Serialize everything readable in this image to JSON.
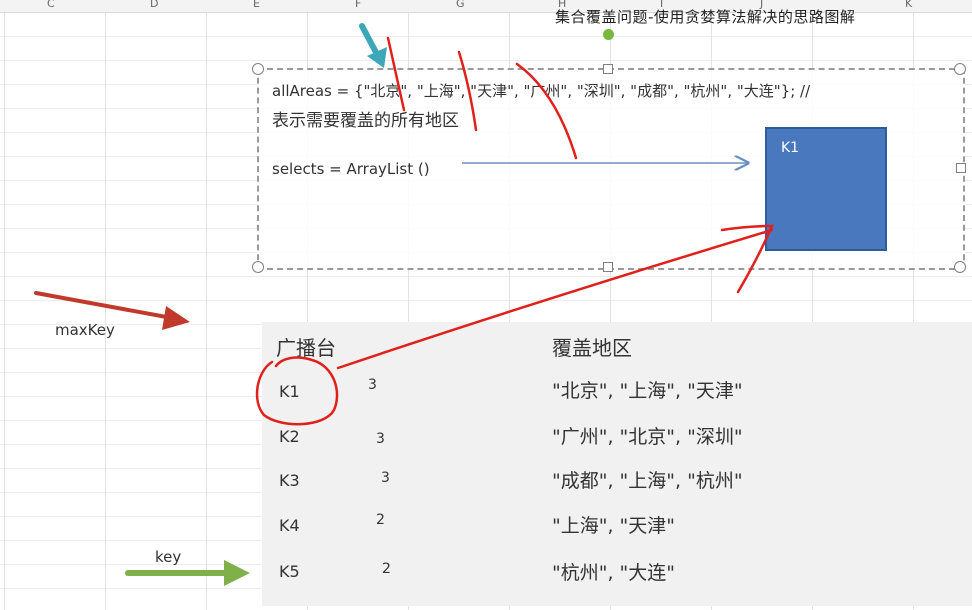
{
  "column_headers": [
    "C",
    "D",
    "E",
    "F",
    "G",
    "H",
    "I",
    "J",
    "K"
  ],
  "title_text": "集合覆盖问题-使用贪婪算法解决的思路图解",
  "code": {
    "line1": "allAreas = {\"北京\", \"上海\", \"天津\", \"广州\", \"深圳\", \"成都\", \"杭州\", \"大连\"}; //",
    "line2": "表示需要覆盖的所有地区",
    "line3": "selects = ArrayList ()"
  },
  "selected_box_label": "K1",
  "labels": {
    "max_key": "maxKey",
    "key": "key"
  },
  "table": {
    "headers": [
      "广播台",
      "覆盖地区"
    ],
    "rows": [
      {
        "key": "K1",
        "count": "3",
        "areas": "\"北京\", \"上海\", \"天津\""
      },
      {
        "key": "K2",
        "count": "3",
        "areas": "\"广州\", \"北京\", \"深圳\""
      },
      {
        "key": "K3",
        "count": "3",
        "areas": "\"成都\", \"上海\", \"杭州\""
      },
      {
        "key": "K4",
        "count": "2",
        "areas": "\"上海\", \"天津\""
      },
      {
        "key": "K5",
        "count": "2",
        "areas": "\"杭州\", \"大连\""
      }
    ]
  },
  "colors": {
    "annotation_red": "#e0201b",
    "arrow_red": "#c0392b",
    "arrow_green": "#7fb04a",
    "arrow_teal": "#3ba7b8",
    "selected_box_fill": "#4a78bf"
  }
}
